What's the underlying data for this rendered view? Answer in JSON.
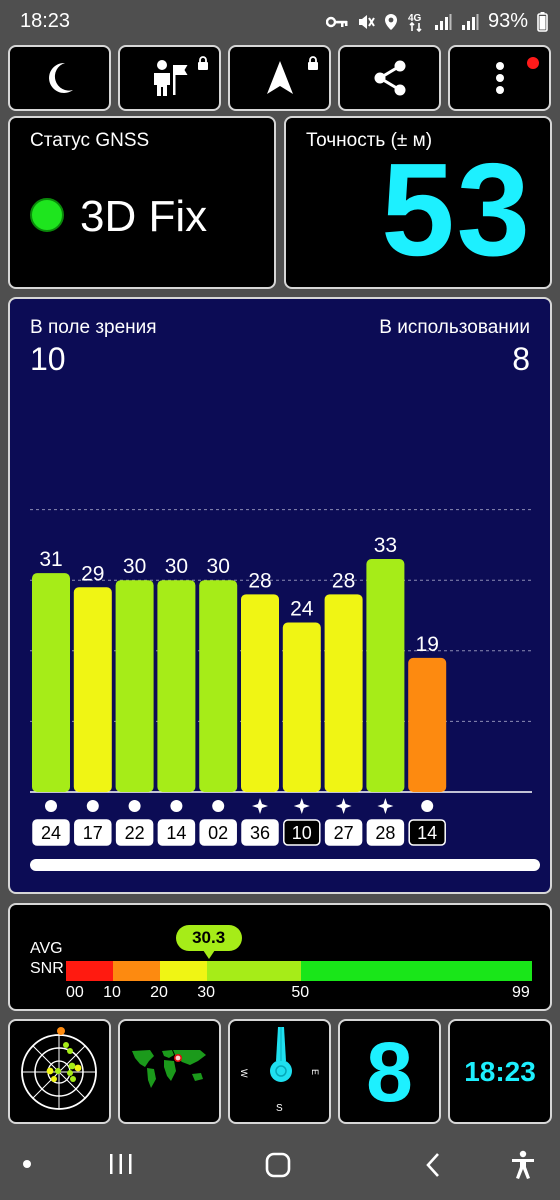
{
  "status_bar": {
    "time": "18:23",
    "network": "4G",
    "battery": "93%",
    "icons": [
      "vpn-key-icon",
      "mute-icon",
      "location-icon",
      "4g-icon",
      "signal-icon",
      "signal-icon",
      "battery-icon"
    ]
  },
  "toolbar": {
    "buttons": [
      "night-mode-moon-icon",
      "person-flag-icon",
      "navigation-arrow-icon",
      "share-icon",
      "more-vert-icon"
    ]
  },
  "gnss": {
    "label": "Статус GNSS",
    "value": "3D Fix",
    "dot_color": "#1ee51e"
  },
  "accuracy": {
    "label": "Точность (± м)",
    "value": "53",
    "color": "#1df0ff"
  },
  "satellites": {
    "in_view_label": "В поле зрения",
    "in_view": "10",
    "in_use_label": "В использовании",
    "in_use": "8",
    "bars": [
      {
        "snr": 31,
        "id": "24",
        "marker": "dot",
        "color": "#a6ec18",
        "in_use": true
      },
      {
        "snr": 29,
        "id": "17",
        "marker": "dot",
        "color": "#f0f514",
        "in_use": true
      },
      {
        "snr": 30,
        "id": "22",
        "marker": "dot",
        "color": "#a6ec18",
        "in_use": true
      },
      {
        "snr": 30,
        "id": "14",
        "marker": "dot",
        "color": "#a6ec18",
        "in_use": true
      },
      {
        "snr": 30,
        "id": "02",
        "marker": "dot",
        "color": "#a6ec18",
        "in_use": true
      },
      {
        "snr": 28,
        "id": "36",
        "marker": "star",
        "color": "#f0f514",
        "in_use": true
      },
      {
        "snr": 24,
        "id": "10",
        "marker": "star",
        "color": "#f0f514",
        "in_use": false
      },
      {
        "snr": 28,
        "id": "27",
        "marker": "star",
        "color": "#f0f514",
        "in_use": true
      },
      {
        "snr": 33,
        "id": "28",
        "marker": "star",
        "color": "#a6ec18",
        "in_use": true
      },
      {
        "snr": 19,
        "id": "14",
        "marker": "dot",
        "color": "#fd8a10",
        "in_use": false
      }
    ]
  },
  "chart_data": {
    "type": "bar",
    "categories": [
      "24",
      "17",
      "22",
      "14",
      "02",
      "36",
      "10",
      "27",
      "28",
      "14"
    ],
    "values": [
      31,
      29,
      30,
      30,
      30,
      28,
      24,
      28,
      33,
      19
    ],
    "ylim": [
      0,
      50
    ],
    "grid": true
  },
  "snr": {
    "label_line1": "AVG",
    "label_line2": "SNR",
    "avg": "30.3",
    "avg_value": 30.3,
    "ticks": [
      "00",
      "10",
      "20",
      "30",
      "50",
      "99"
    ],
    "segments": [
      {
        "from": 0,
        "to": 10,
        "color": "#ff1a10"
      },
      {
        "from": 10,
        "to": 20,
        "color": "#fd8a10"
      },
      {
        "from": 20,
        "to": 30,
        "color": "#f0f514"
      },
      {
        "from": 30,
        "to": 50,
        "color": "#a6ec18"
      },
      {
        "from": 50,
        "to": 99,
        "color": "#19e619"
      }
    ]
  },
  "bottom": {
    "sky_view_icon": "satellite-radar-icon",
    "world_map_icon": "world-map-icon",
    "compass": {
      "icon": "compass-icon",
      "w": "W",
      "e": "E",
      "s": "S"
    },
    "in_use_big": "8",
    "time_big": "18:23"
  },
  "nav_bar": {
    "buttons": [
      "dot-icon",
      "recents-icon",
      "home-icon",
      "back-icon",
      "accessibility-icon"
    ]
  }
}
